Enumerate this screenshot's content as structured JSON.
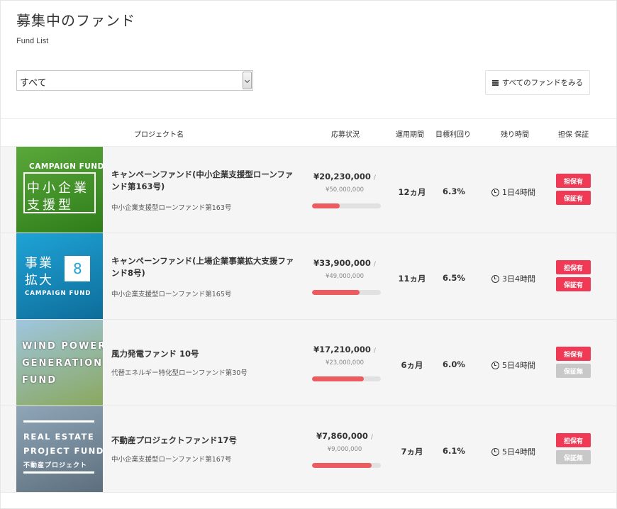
{
  "page": {
    "title": "募集中のファンド",
    "subtitle": "Fund List"
  },
  "filter": {
    "selected": "すべて"
  },
  "all_funds_button": {
    "icon": "list-icon",
    "label": "すべてのファンドをみる"
  },
  "table": {
    "headers": {
      "project": "プロジェクト名",
      "status": "応募状況",
      "period": "運用期間",
      "rate": "目標利回り",
      "remaining": "残り時間",
      "collateral": "担保 保証"
    }
  },
  "funds": [
    {
      "thumb": {
        "lines": [
          "CAMPAIGN FUND",
          "中小企業",
          "支援型"
        ],
        "colors": [
          "#5aa83a",
          "#2e7d1a"
        ]
      },
      "name": "キャンペーンファンド(中小企業支援型ローンファンド第163号)",
      "subname": "中小企業支援型ローンファンド第163号",
      "amount": "¥20,230,000",
      "target": "¥50,000,000",
      "progress": 0.4,
      "period": "12ヵ月",
      "rate": "6.3%",
      "remaining": "1日4時間",
      "collateral": "担保有",
      "guarantee": "保証有",
      "guarantee_active": true
    },
    {
      "thumb": {
        "lines": [
          "事業",
          "拡大",
          "8",
          "CAMPAIGN FUND"
        ],
        "colors": [
          "#1fa3d6",
          "#0e6d9a"
        ]
      },
      "name": "キャンペーンファンド(上場企業事業拡大支援ファンド8号)",
      "subname": "中小企業支援型ローンファンド第165号",
      "amount": "¥33,900,000",
      "target": "¥49,000,000",
      "progress": 0.69,
      "period": "11ヵ月",
      "rate": "6.5%",
      "remaining": "3日4時間",
      "collateral": "担保有",
      "guarantee": "保証有",
      "guarantee_active": true
    },
    {
      "thumb": {
        "lines": [
          "WIND POWER",
          "GENERATION",
          "FUND"
        ],
        "colors": [
          "#9fc6e0",
          "#8aa85e"
        ]
      },
      "name": "風力発電ファンド 10号",
      "subname": "代替エネルギー特化型ローンファンド第30号",
      "amount": "¥17,210,000",
      "target": "¥23,000,000",
      "progress": 0.75,
      "period": "6ヵ月",
      "rate": "6.0%",
      "remaining": "5日4時間",
      "collateral": "担保有",
      "guarantee": "保証無",
      "guarantee_active": false
    },
    {
      "thumb": {
        "lines": [
          "REAL ESTATE",
          "PROJECT FUND",
          "不動産プロジェクト"
        ],
        "colors": [
          "#8fa6b8",
          "#5d6f7d"
        ]
      },
      "name": "不動産プロジェクトファンド17号",
      "subname": "中小企業支援型ローンファンド第167号",
      "amount": "¥7,860,000",
      "target": "¥9,000,000",
      "progress": 0.87,
      "period": "7ヵ月",
      "rate": "6.1%",
      "remaining": "5日4時間",
      "collateral": "担保有",
      "guarantee": "保証無",
      "guarantee_active": false
    }
  ],
  "separator": "/"
}
